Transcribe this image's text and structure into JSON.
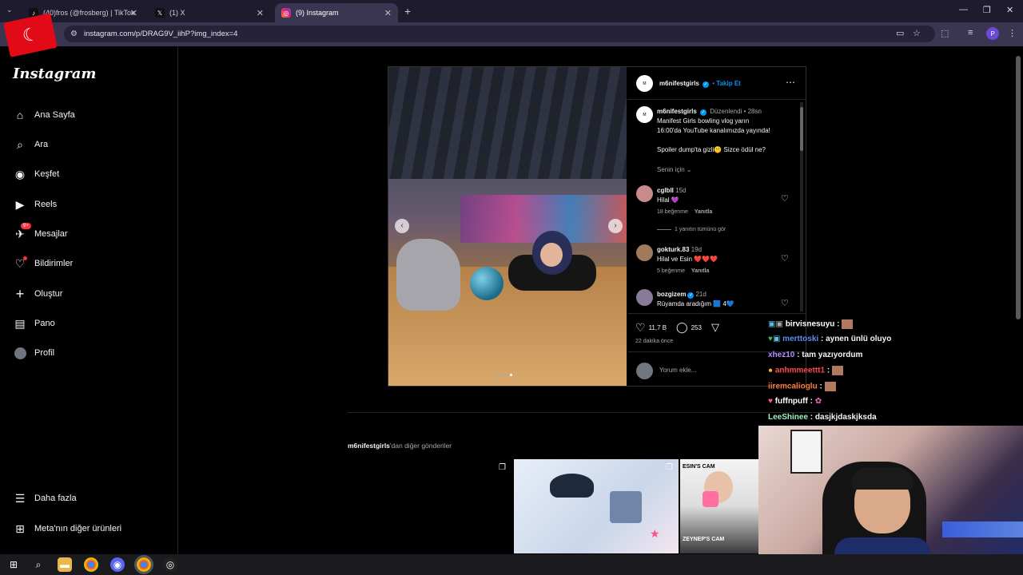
{
  "browser": {
    "tabs": [
      {
        "title": "(40)fros (@frosberg) | TikTok",
        "icon": "tiktok-icon",
        "active": false
      },
      {
        "title": "(1) X",
        "icon": "x-icon",
        "active": false
      },
      {
        "title": "(9) Instagram",
        "icon": "instagram-icon",
        "active": true
      }
    ],
    "url": "instagram.com/p/DRAG9V_iihP?img_index=4",
    "profile_initial": "P"
  },
  "sidebar": {
    "logo": "Instagram",
    "items": [
      {
        "label": "Ana Sayfa",
        "icon": "home-icon"
      },
      {
        "label": "Ara",
        "icon": "search-icon"
      },
      {
        "label": "Keşfet",
        "icon": "compass-icon"
      },
      {
        "label": "Reels",
        "icon": "reels-icon"
      },
      {
        "label": "Mesajlar",
        "icon": "messenger-icon",
        "badge": "9+"
      },
      {
        "label": "Bildirimler",
        "icon": "heart-icon"
      },
      {
        "label": "Oluştur",
        "icon": "plus-icon"
      },
      {
        "label": "Pano",
        "icon": "dashboard-icon"
      },
      {
        "label": "Profil",
        "icon": "avatar"
      }
    ],
    "bottom": [
      {
        "label": "Daha fazla",
        "icon": "menu-icon"
      },
      {
        "label": "Meta'nın diğer ürünleri",
        "icon": "meta-products-icon"
      }
    ]
  },
  "post": {
    "header": {
      "username": "m6nifestgirls",
      "follow": "Takip Et",
      "separator": "•"
    },
    "caption": {
      "username": "m6nifestgirls",
      "edited": "Düzenlendi",
      "time": "28sn",
      "line1": "Manifest Girls bowling vlog yarın",
      "line2": "16:00'da YouTube kanalımızda yayında!",
      "line3": "Spoiler dump'ta gizli🤫 Sizce ödül ne?"
    },
    "for_you": "Senin için",
    "comments": [
      {
        "user": "cglbll",
        "time": "15d",
        "text": "Hilal 💜",
        "likes": "18 beğenme",
        "reply": "Yanıtla"
      },
      {
        "user": "gokturk.83",
        "time": "19d",
        "text": "Hilal ve Esin ❤️❤️❤️",
        "likes": "5 beğenme",
        "reply": "Yanıtla"
      },
      {
        "user": "bozgizem",
        "time": "21d",
        "text": "Rüyamda aradığım 🟦 4💙",
        "likes": "",
        "reply": ""
      }
    ],
    "view_replies": "1 yanıtın tümünü gör",
    "likes": "11,7 B",
    "comment_count": "253",
    "posted_ago": "22 dakika önce",
    "add_comment": "Yorum ekle..."
  },
  "more_posts": {
    "username": "m6nifestgirls",
    "suffix": "'dan diğer gönderiler",
    "thumb2_top": "ESIN'S CAM",
    "thumb2_bottom": "ZEYNEP'S CAM"
  },
  "chat": [
    {
      "user": "birvisnesuyu",
      "msg": " :",
      "color": "#ffffff"
    },
    {
      "user": "merttoski",
      "msg": " : aynen ünlü oluyo",
      "color": "#5b8def"
    },
    {
      "user": "xhez10",
      "msg": " : tam yazıyordum",
      "color": "#b98cff"
    },
    {
      "user": "anhmmeettt1",
      "msg": " :",
      "color": "#ff4a4a"
    },
    {
      "user": "iiremcalioglu",
      "msg": " :",
      "color": "#ff7a3c"
    },
    {
      "user": "fuffnpuff",
      "msg": " :",
      "color": "#ffffff"
    },
    {
      "user": "LeeShinee",
      "msg": " : dasjkjdaskjksda",
      "color": "#9ef0c0"
    }
  ],
  "colors": {
    "accent": "#0095f6",
    "badge": "#ff3040",
    "chrome_bg": "#1f1b2e"
  }
}
